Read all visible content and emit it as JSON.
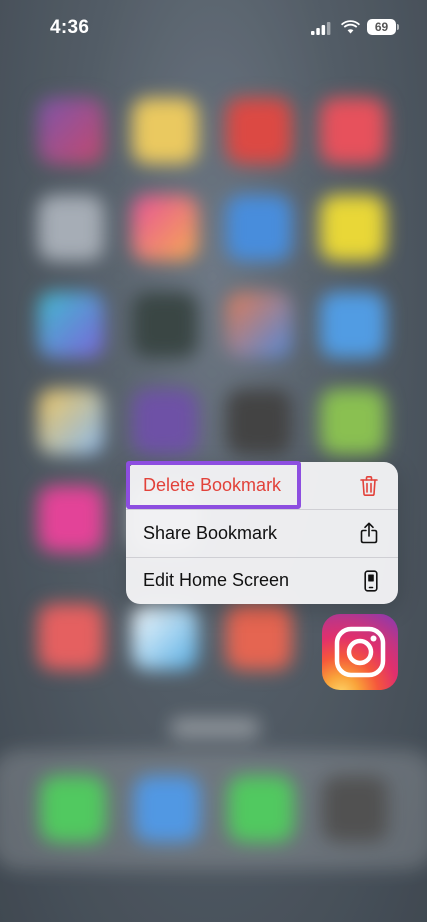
{
  "status_bar": {
    "time": "4:36",
    "battery": "69"
  },
  "context_menu": {
    "items": [
      {
        "label": "Delete Bookmark",
        "icon": "trash-icon",
        "color": "#e2423a"
      },
      {
        "label": "Share Bookmark",
        "icon": "share-icon"
      },
      {
        "label": "Edit Home Screen",
        "icon": "phone-icon"
      }
    ]
  },
  "app_icon": {
    "name": "instagram-icon"
  },
  "colors": {
    "highlight": "#8d4ee0",
    "destructive": "#e2423a"
  }
}
